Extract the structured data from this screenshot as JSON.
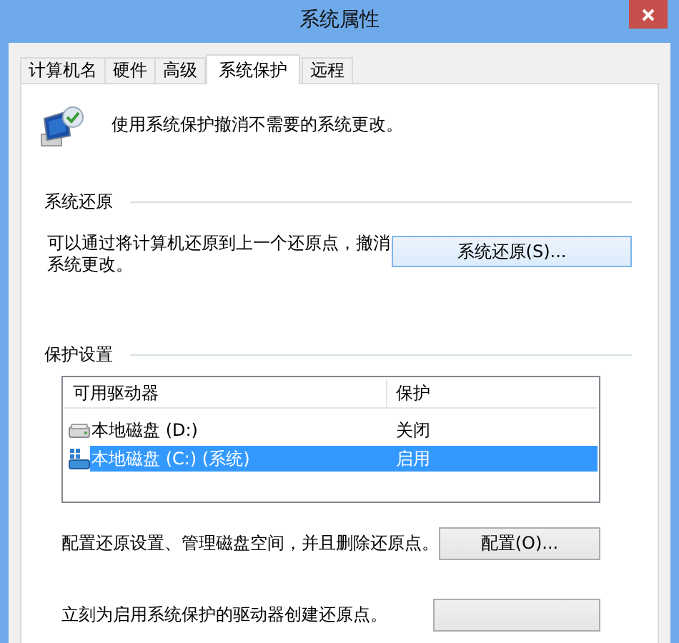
{
  "window": {
    "title": "系统属性"
  },
  "tabs": [
    {
      "label": "计算机名",
      "selected": false
    },
    {
      "label": "硬件",
      "selected": false
    },
    {
      "label": "高级",
      "selected": false
    },
    {
      "label": "系统保护",
      "selected": true
    },
    {
      "label": "远程",
      "selected": false
    }
  ],
  "intro": "使用系统保护撤消不需要的系统更改。",
  "restore": {
    "heading": "系统还原",
    "description": "可以通过将计算机还原到上一个还原点，撤消系统更改。",
    "button": "系统还原(S)..."
  },
  "protection": {
    "heading": "保护设置",
    "columns": [
      "可用驱动器",
      "保护"
    ],
    "drives": [
      {
        "kind": "disk",
        "name": "本地磁盘 (D:)",
        "status": "关闭",
        "selected": false
      },
      {
        "kind": "system",
        "name": "本地磁盘 (C:) (系统)",
        "status": "启用",
        "selected": true
      }
    ],
    "configure": {
      "description": "配置还原设置、管理磁盘空间，并且删除还原点。",
      "button": "配置(O)..."
    },
    "create": {
      "description": "立刻为启用系统保护的驱动器创建还原点。"
    }
  }
}
